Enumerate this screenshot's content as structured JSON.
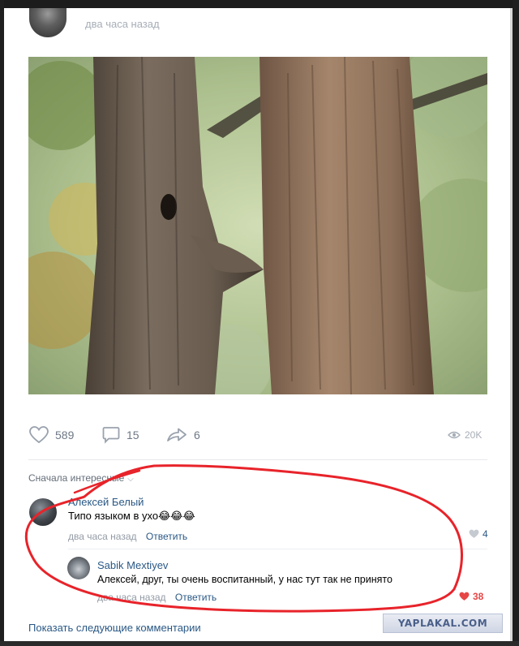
{
  "post": {
    "time": "два часа назад",
    "photo_alt": "Two tree trunks"
  },
  "stats": {
    "likes": "589",
    "comments": "15",
    "shares": "6",
    "views": "20K"
  },
  "comments_section": {
    "sort_label": "Сначала интересные",
    "comments": [
      {
        "author": "Алексей Белый",
        "text": "Типо языком в ухо😂😂😂",
        "time": "два часа назад",
        "reply_label": "Ответить",
        "likes": "4"
      },
      {
        "author": "Sabik Mextiyev",
        "text": "Алексей, друг, ты очень воспитанный, у нас тут так не принято",
        "time": "два часа назад",
        "reply_label": "Ответить",
        "likes": "38"
      }
    ],
    "more_label": "Показать следующие комментарии"
  },
  "watermark": "YAPLAKAL.COM",
  "colors": {
    "link": "#2a5885",
    "secondary": "#939ba5",
    "liked": "#e64646",
    "annotation_red": "#e8232a"
  }
}
